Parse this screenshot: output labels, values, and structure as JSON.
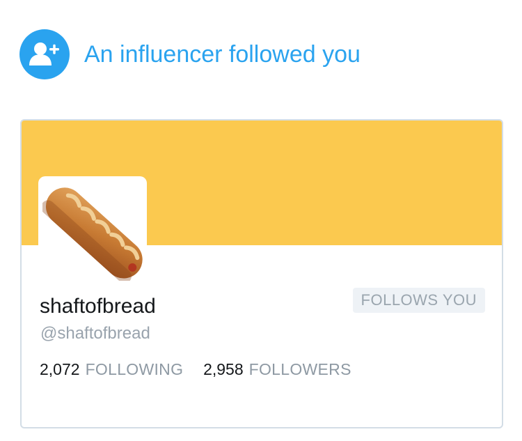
{
  "notification": {
    "icon": "follow-user-icon",
    "title": "An influencer followed you"
  },
  "profile": {
    "display_name": "shaftofbread",
    "handle": "@shaftofbread",
    "follows_you_label": "FOLLOWS YOU",
    "avatar": "baguette",
    "banner_color": "#fbc94f",
    "following_count": "2,072",
    "following_label": "FOLLOWING",
    "followers_count": "2,958",
    "followers_label": "FOLLOWERS"
  },
  "colors": {
    "accent": "#2aa3ef",
    "banner": "#fbc94f"
  }
}
